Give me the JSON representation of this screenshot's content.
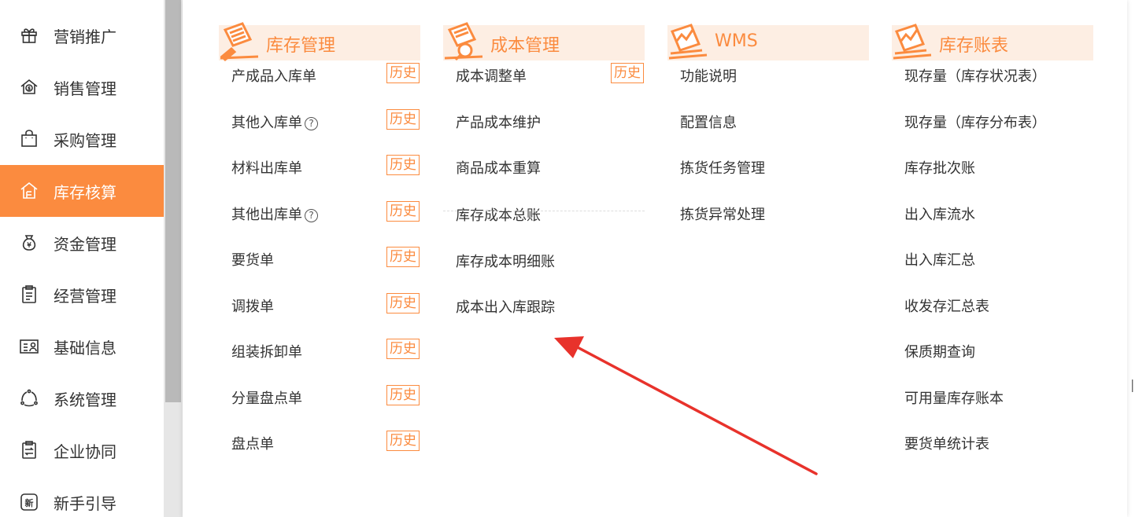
{
  "sidebar": {
    "items": [
      {
        "label": "营销推广",
        "icon": "gift-icon"
      },
      {
        "label": "销售管理",
        "icon": "sales-icon"
      },
      {
        "label": "采购管理",
        "icon": "shopping-bag-icon"
      },
      {
        "label": "库存核算",
        "icon": "warehouse-icon"
      },
      {
        "label": "资金管理",
        "icon": "money-bag-icon"
      },
      {
        "label": "经营管理",
        "icon": "clipboard-icon"
      },
      {
        "label": "基础信息",
        "icon": "id-card-icon"
      },
      {
        "label": "系统管理",
        "icon": "system-cycle-icon"
      },
      {
        "label": "企业协同",
        "icon": "collaboration-icon"
      },
      {
        "label": "新手引导",
        "icon": "new-badge-icon"
      }
    ],
    "active_index": 3
  },
  "columns": [
    {
      "title": "库存管理",
      "icon": "document-pen-icon",
      "items": [
        {
          "label": "产成品入库单",
          "history": "历史"
        },
        {
          "label": "其他入库单",
          "help": "?",
          "history": "历史"
        },
        {
          "label": "材料出库单",
          "history": "历史"
        },
        {
          "label": "其他出库单",
          "help": "?",
          "history": "历史"
        },
        {
          "label": "要货单",
          "history": "历史"
        },
        {
          "label": "调拨单",
          "history": "历史"
        },
        {
          "label": "组装拆卸单",
          "history": "历史"
        },
        {
          "label": "分量盘点单",
          "history": "历史"
        },
        {
          "label": "盘点单",
          "history": "历史"
        }
      ]
    },
    {
      "title": "成本管理",
      "icon": "document-search-icon",
      "items": [
        {
          "label": "成本调整单",
          "history": "历史"
        },
        {
          "label": "产品成本维护"
        },
        {
          "label": "商品成本重算"
        },
        {
          "label": "库存成本总账"
        },
        {
          "label": "库存成本明细账"
        },
        {
          "label": "成本出入库跟踪"
        }
      ]
    },
    {
      "title": "WMS",
      "icon": "chart-document-icon",
      "items": [
        {
          "label": "功能说明"
        },
        {
          "label": "配置信息"
        },
        {
          "label": "拣货任务管理"
        },
        {
          "label": "拣货异常处理"
        }
      ]
    },
    {
      "title": "库存账表",
      "icon": "chart-document-icon",
      "items": [
        {
          "label": "现存量（库存状况表）"
        },
        {
          "label": "现存量（库存分布表）"
        },
        {
          "label": "库存批次账"
        },
        {
          "label": "出入库流水"
        },
        {
          "label": "出入库汇总"
        },
        {
          "label": "收发存汇总表"
        },
        {
          "label": "保质期查询"
        },
        {
          "label": "可用量库存账本"
        },
        {
          "label": "要货单统计表"
        }
      ]
    }
  ],
  "colors": {
    "accent": "#fb8b3f",
    "header_bg": "#fdeee3",
    "annotation_arrow": "#e8322b"
  },
  "annotation": {
    "type": "arrow",
    "points_to": "成本出入库跟踪"
  }
}
